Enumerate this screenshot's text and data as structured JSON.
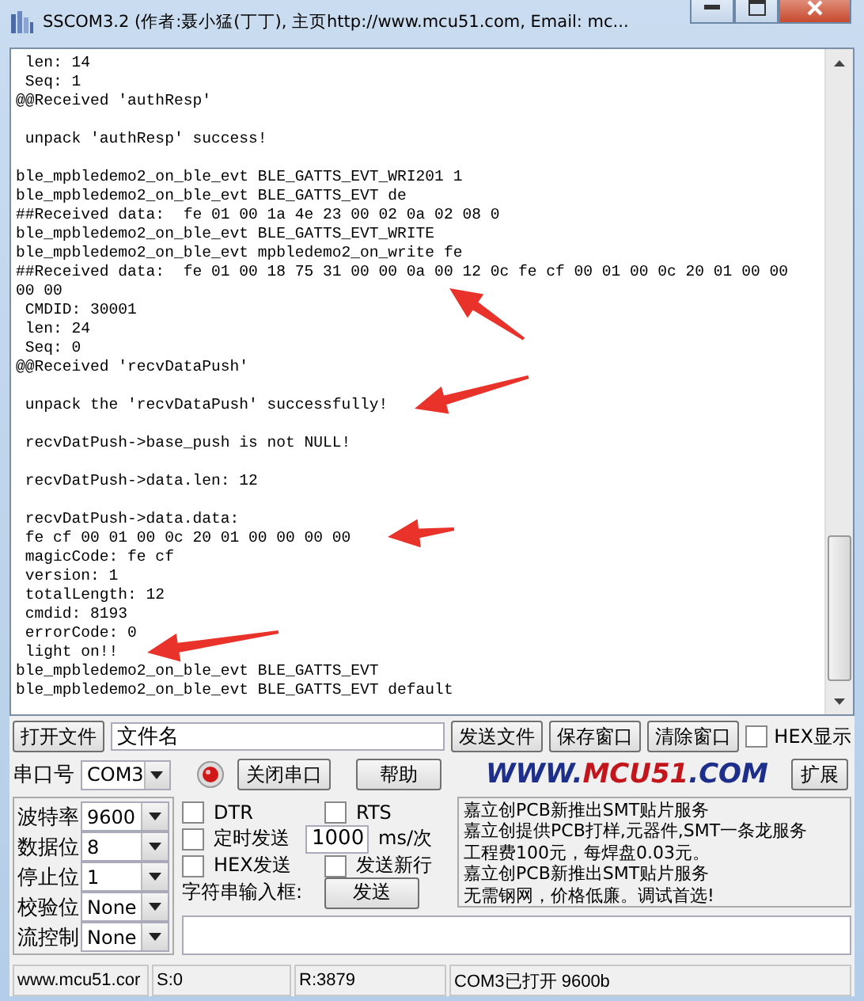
{
  "window": {
    "title": "SSCOM3.2 (作者:聂小猛(丁丁), 主页http://www.mcu51.com,  Email: mc..."
  },
  "log": {
    "lines": [
      {
        "text": " len: 14",
        "blank_before": false
      },
      {
        "text": " Seq: 1",
        "blank_before": false
      },
      {
        "text": "@@Received 'authResp'",
        "blank_before": false
      },
      {
        "text": " unpack 'authResp' success!",
        "blank_before": true
      },
      {
        "text": "ble_mpbledemo2_on_ble_evt BLE_GATTS_EVT_WRI201 1",
        "blank_before": true
      },
      {
        "text": "ble_mpbledemo2_on_ble_evt BLE_GATTS_EVT de",
        "blank_before": false
      },
      {
        "text": "##Received data:  fe 01 00 1a 4e 23 00 02 0a 02 08 0",
        "blank_before": false
      },
      {
        "text": "ble_mpbledemo2_on_ble_evt BLE_GATTS_EVT_WRITE",
        "blank_before": false
      },
      {
        "text": "ble_mpbledemo2_on_ble_evt mpbledemo2_on_write fe",
        "blank_before": false
      },
      {
        "text": "##Received data:  fe 01 00 18 75 31 00 00 0a 00 12 0c fe cf 00 01 00 0c 20 01 00 00",
        "blank_before": false
      },
      {
        "text": "00 00",
        "blank_before": false
      },
      {
        "text": " CMDID: 30001",
        "blank_before": false
      },
      {
        "text": " len: 24",
        "blank_before": false
      },
      {
        "text": " Seq: 0",
        "blank_before": false
      },
      {
        "text": "@@Received 'recvDataPush'",
        "blank_before": false
      },
      {
        "text": " unpack the 'recvDataPush' successfully!",
        "blank_before": true
      },
      {
        "text": " recvDatPush->base_push is not NULL!",
        "blank_before": true
      },
      {
        "text": " recvDatPush->data.len: 12",
        "blank_before": true
      },
      {
        "text": " recvDatPush->data.data:",
        "blank_before": true
      },
      {
        "text": " fe cf 00 01 00 0c 20 01 00 00 00 00",
        "blank_before": false
      },
      {
        "text": " magicCode: fe cf",
        "blank_before": false
      },
      {
        "text": " version: 1",
        "blank_before": false
      },
      {
        "text": " totalLength: 12",
        "blank_before": false
      },
      {
        "text": " cmdid: 8193",
        "blank_before": false
      },
      {
        "text": " errorCode: 0",
        "blank_before": false
      },
      {
        "text": " light on!!",
        "blank_before": false
      },
      {
        "text": "ble_mpbledemo2_on_ble_evt BLE_GATTS_EVT",
        "blank_before": false
      },
      {
        "text": "ble_mpbledemo2_on_ble_evt BLE_GATTS_EVT default",
        "blank_before": false
      }
    ]
  },
  "file_row": {
    "open_button": "打开文件",
    "file_field": "文件名",
    "buttons": [
      "发送文件",
      "保存窗口",
      "清除窗口"
    ],
    "hex_display": {
      "label": "HEX显示",
      "checked": false
    }
  },
  "port_row": {
    "label": "串口号",
    "port": "COM3",
    "port_open": true,
    "toggle_button": "关闭串口",
    "help_button": "帮助",
    "logo": {
      "prefix": "WWW.",
      "brand": "MCU51",
      "suffix": ".COM"
    },
    "expand_button": "扩展"
  },
  "settings": [
    {
      "label": "波特率",
      "value": "9600"
    },
    {
      "label": "数据位",
      "value": "8"
    },
    {
      "label": "停止位",
      "value": "1"
    },
    {
      "label": "校验位",
      "value": "None"
    },
    {
      "label": "流控制",
      "value": "None"
    }
  ],
  "send_options": {
    "dtr": {
      "label": "DTR",
      "checked": false
    },
    "rts": {
      "label": "RTS",
      "checked": false
    },
    "timed_send": {
      "label": "定时发送",
      "checked": false
    },
    "interval": "1000",
    "interval_unit": "ms/次",
    "hex_send": {
      "label": "HEX发送",
      "checked": false
    },
    "send_newline": {
      "label": "发送新行",
      "checked": false
    },
    "input_label": "字符串输入框:",
    "send_button": "发送"
  },
  "ad_lines": [
    "嘉立创PCB新推出SMT贴片服务",
    "嘉立创提供PCB打样,元器件,SMT一条龙服务",
    "工程费100元，每焊盘0.03元。",
    "嘉立创PCB新推出SMT贴片服务",
    "无需钢网，价格低廉。调试首选!"
  ],
  "status_bar": [
    "www.mcu51.cor",
    "S:0",
    "R:3879",
    "COM3已打开  9600b"
  ]
}
